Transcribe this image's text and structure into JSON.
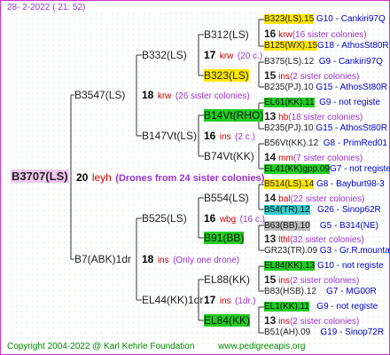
{
  "header": {
    "date": "28-  2-2022  ( 21: 52)"
  },
  "footer": {
    "copyright": "Copyright 2004-2022 @ Karl Kehrle Foundation",
    "website": "www.pedigreeapis.org"
  },
  "root": {
    "name": "B3707(LS)",
    "year": "20",
    "breeder": "leyh",
    "note": "(Drones from 24 sister colonies)"
  },
  "gen1": [
    {
      "name": "B3547(LS)",
      "year": "18",
      "breeder": "krw",
      "note": "(26 sister colonies)"
    },
    {
      "name": "B7(ABK)1dr",
      "year": "18",
      "breeder": "ins",
      "note": "(Only one drone)"
    }
  ],
  "gen2": [
    {
      "name": "B332(LS)",
      "year": "17",
      "breeder": "krw",
      "note": "(20 c.)"
    },
    {
      "name": "B147Vt(LS)",
      "year": "16",
      "breeder": "ins",
      "note": "(2 c.)"
    },
    {
      "name": "B525(LS)",
      "year": "16",
      "breeder": "wbg",
      "note": "(16 c.)"
    },
    {
      "name": "EL44(KK)1dr",
      "year": "17",
      "breeder": "ins",
      "note": "(1dr.)"
    }
  ],
  "gen3": [
    {
      "name": "B312(LS)"
    },
    {
      "name": "B323(LS)"
    },
    {
      "name": "B14Vt(RHO)"
    },
    {
      "name": "B74Vt(KK)"
    },
    {
      "name": "B554(LS)"
    },
    {
      "name": "B91(BB)"
    },
    {
      "name": "EL88(KK)"
    },
    {
      "name": "EL84(KK)"
    }
  ],
  "gen4": [
    {
      "name": "B323(LS).15",
      "num": "G10 - Cankiri97Q"
    },
    {
      "year": "16",
      "breeder": "krw",
      "note": "(16 sister colonies)"
    },
    {
      "name": "B125(WX).15",
      "num": "G18 - AthosSt80R"
    },
    {
      "name": "B375(LS).12",
      "num": "G9 - Cankiri97Q"
    },
    {
      "year": "15",
      "breeder": "ins",
      "note": "(2 sister colonies)"
    },
    {
      "name": "B235(PJ).10",
      "num": "G15 - AthosSt80R"
    },
    {
      "name": "EL61(KK).11",
      "num": "G9 - not registe"
    },
    {
      "year": "13",
      "breeder": "hb",
      "note": "(18 sister colonies)"
    },
    {
      "name": "B235(PJ).10",
      "num": "G15 - AthosSt80R"
    },
    {
      "name": "B56Vt(KK).12",
      "num": "G8 - PrimRed01"
    },
    {
      "year": "14",
      "breeder": "mm",
      "note": "(7 sister colonies)"
    },
    {
      "name": "EL41(KK)gpp.09",
      "num": "G7 - not registe"
    },
    {
      "name": "B514(LS).14",
      "num": "G8 - Bayburt98-3"
    },
    {
      "year": "14",
      "breeder": "bal",
      "note": "(22 sister colonies)"
    },
    {
      "name": "B54(TR).12",
      "num": "G26 - Sinop62R"
    },
    {
      "name": "B63(BB).10",
      "num": "G5 - B314(NE)"
    },
    {
      "year": "13",
      "breeder": "lthl",
      "note": "(32 sister colonies)"
    },
    {
      "name": "GR23(TR).09",
      "num": "G3 - Gr.R.mounta"
    },
    {
      "name": "EL84(KK).13",
      "num": "G10 - not registe"
    },
    {
      "year": "15",
      "breeder": "ins",
      "note": "(2 sister colonies)"
    },
    {
      "name": "B83(HSB).12",
      "num": "G7 - MG00R"
    },
    {
      "name": "EL1(KK).11",
      "num": "G9 - not registe"
    },
    {
      "year": "13",
      "breeder": "ins",
      "note": "(2 sister colonies)"
    },
    {
      "name": "B51(AH).09",
      "num": "G19 - Sinop72R"
    }
  ]
}
